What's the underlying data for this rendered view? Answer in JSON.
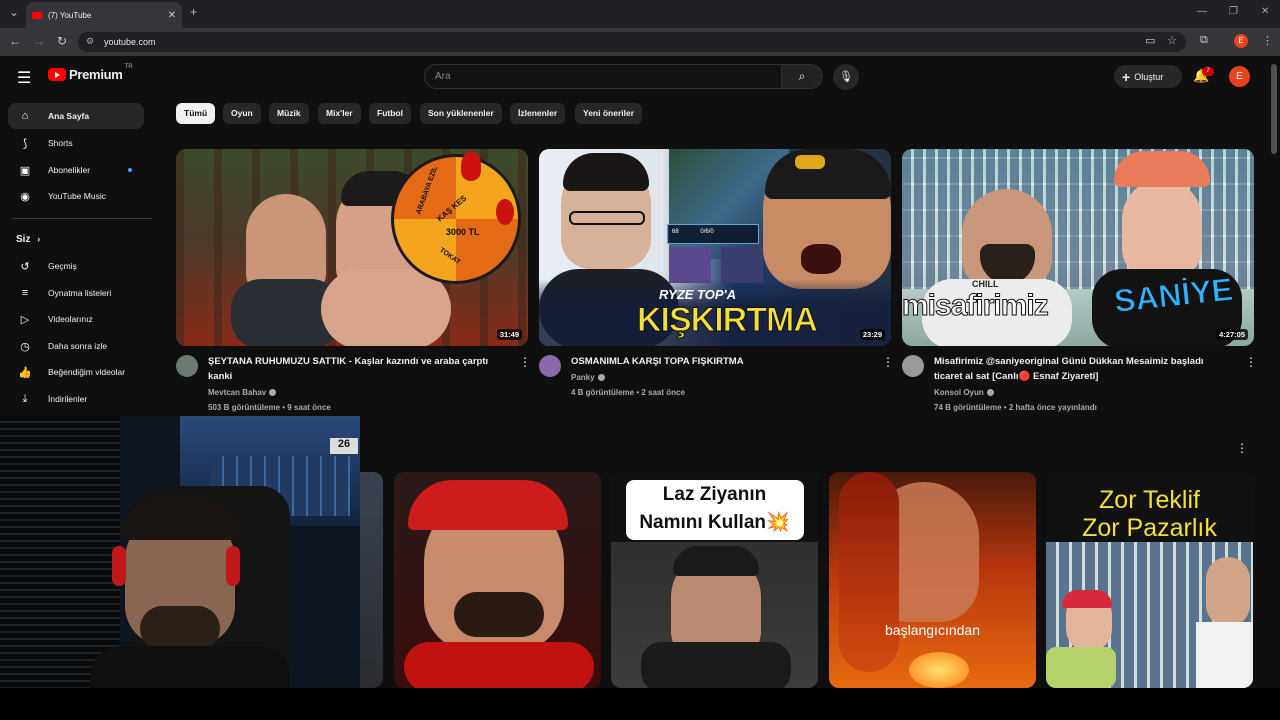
{
  "browser": {
    "tab_title": "(7) YouTube",
    "url": "youtube.com",
    "profile_letter": "E"
  },
  "header": {
    "logo_word": "Premium",
    "logo_country": "TR",
    "search_placeholder": "Ara",
    "create_label": "Oluştur",
    "notification_count": "7",
    "avatar_letter": "E"
  },
  "sidebar": {
    "main": [
      {
        "label": "Ana Sayfa",
        "icon": "home-icon"
      },
      {
        "label": "Shorts",
        "icon": "shorts-icon"
      },
      {
        "label": "Abonelikler",
        "icon": "subscriptions-icon"
      },
      {
        "label": "YouTube Music",
        "icon": "music-icon"
      }
    ],
    "you_title": "Siz",
    "you": [
      {
        "label": "Geçmiş",
        "icon": "history-icon"
      },
      {
        "label": "Oynatma listeleri",
        "icon": "playlist-icon"
      },
      {
        "label": "Videolarınız",
        "icon": "your-videos-icon"
      },
      {
        "label": "Daha sonra izle",
        "icon": "watch-later-icon"
      },
      {
        "label": "Beğendiğim videolar",
        "icon": "like-icon"
      },
      {
        "label": "İndirilenler",
        "icon": "download-icon"
      }
    ]
  },
  "chips": [
    "Tümü",
    "Oyun",
    "Müzik",
    "Mix'ler",
    "Futbol",
    "Son yüklenenler",
    "İzlenenler",
    "Yeni öneriler"
  ],
  "videos": [
    {
      "title_line1": "ŞEYTANA RUHUMUZU SATTIK - Kaşlar kazındı ve araba çarptı",
      "title_line2": "kanki",
      "channel": "Mevtcan Bahav",
      "stats": "503 B görüntüleme • 9 saat önce",
      "duration": "31:49",
      "wheel_labels": [
        "ARABAYA EZİL",
        "KAŞ KES",
        "3000 TL",
        "TOKAT"
      ]
    },
    {
      "title_line1": "OSMANIMLA KARŞI TOPA FIŞKIRTMA",
      "title_line2": "",
      "channel": "Panky",
      "stats": "4 B görüntüleme • 2 saat önce",
      "duration": "23:29",
      "thumb_small": "RYZE TOP'A",
      "thumb_big": "KIŞKIRTMA",
      "thumb_score": "0/6/0",
      "thumb_level": "68"
    },
    {
      "title_line1": "Misafirimiz @saniyeoriginal   Günü Dükkan Mesaimiz başladı",
      "title_line2": "ticaret al sat [Canlı🔴 Esnaf Ziyareti]",
      "channel": "Konsol Oyun",
      "stats": "74 B görüntüleme • 2 hafta önce yayınlandı",
      "duration": "4:27:05",
      "thumb_text_white": "misafirimiz",
      "thumb_text_blue": "SANİYE",
      "shirt_text": "CHILL"
    }
  ],
  "shorts": [
    {
      "text": ""
    },
    {
      "text": ""
    },
    {
      "text": "Laz Ziyanın Namını Kullan💥",
      "line1": "Laz Ziyanın",
      "line2": "Namını Kullan💥"
    },
    {
      "text": "başlangıcından"
    },
    {
      "line1": "Zor Teklif",
      "line2": "Zor Pazarlık"
    }
  ],
  "webcam": {
    "corner_number": "26"
  }
}
